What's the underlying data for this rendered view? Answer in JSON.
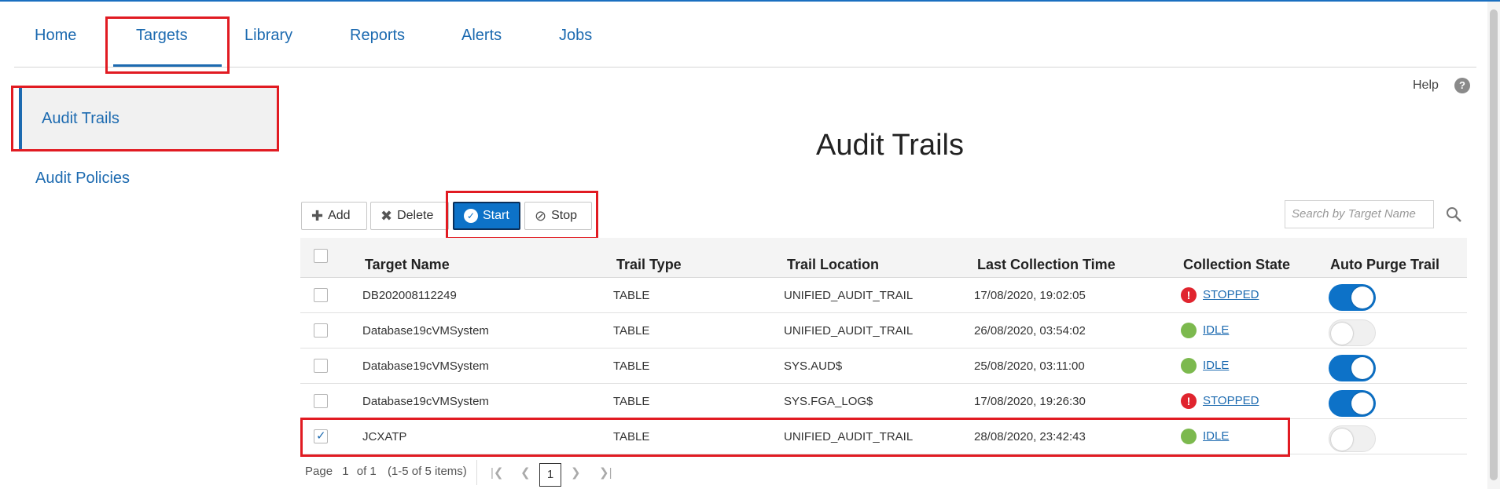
{
  "nav": {
    "items": [
      {
        "label": "Home"
      },
      {
        "label": "Targets"
      },
      {
        "label": "Library"
      },
      {
        "label": "Reports"
      },
      {
        "label": "Alerts"
      },
      {
        "label": "Jobs"
      }
    ],
    "active": "Targets"
  },
  "sidebar": {
    "items": [
      {
        "label": "Audit Trails"
      },
      {
        "label": "Audit Policies"
      }
    ],
    "active": "Audit Trails"
  },
  "help": {
    "label": "Help",
    "icon": "?"
  },
  "page": {
    "title": "Audit Trails"
  },
  "toolbar": {
    "add_label": "Add",
    "delete_label": "Delete",
    "start_label": "Start",
    "stop_label": "Stop",
    "search_placeholder": "Search by Target Name"
  },
  "table": {
    "columns": [
      "Target Name",
      "Trail Type",
      "Trail Location",
      "Last Collection Time",
      "Collection State",
      "Auto Purge Trail"
    ],
    "rows": [
      {
        "target": "DB202008112249",
        "type": "TABLE",
        "location": "UNIFIED_AUDIT_TRAIL",
        "time": "17/08/2020, 19:02:05",
        "state": "STOPPED",
        "auto_purge": true,
        "checked": false
      },
      {
        "target": "Database19cVMSystem",
        "type": "TABLE",
        "location": "UNIFIED_AUDIT_TRAIL",
        "time": "26/08/2020, 03:54:02",
        "state": "IDLE",
        "auto_purge": false,
        "checked": false
      },
      {
        "target": "Database19cVMSystem",
        "type": "TABLE",
        "location": "SYS.AUD$",
        "time": "25/08/2020, 03:11:00",
        "state": "IDLE",
        "auto_purge": true,
        "checked": false
      },
      {
        "target": "Database19cVMSystem",
        "type": "TABLE",
        "location": "SYS.FGA_LOG$",
        "time": "17/08/2020, 19:26:30",
        "state": "STOPPED",
        "auto_purge": true,
        "checked": false
      },
      {
        "target": "JCXATP",
        "type": "TABLE",
        "location": "UNIFIED_AUDIT_TRAIL",
        "time": "28/08/2020, 23:42:43",
        "state": "IDLE",
        "auto_purge": false,
        "checked": true
      }
    ]
  },
  "pagination": {
    "page_label": "Page",
    "page": "1",
    "of_label": "of 1",
    "items_label": "(1-5 of 5 items)",
    "current": "1"
  },
  "colors": {
    "accent": "#1c6ab0",
    "highlight": "#e11b22",
    "stopped": "#e0242e",
    "idle": "#7cb94e",
    "toggle_on": "#0d72c8"
  }
}
